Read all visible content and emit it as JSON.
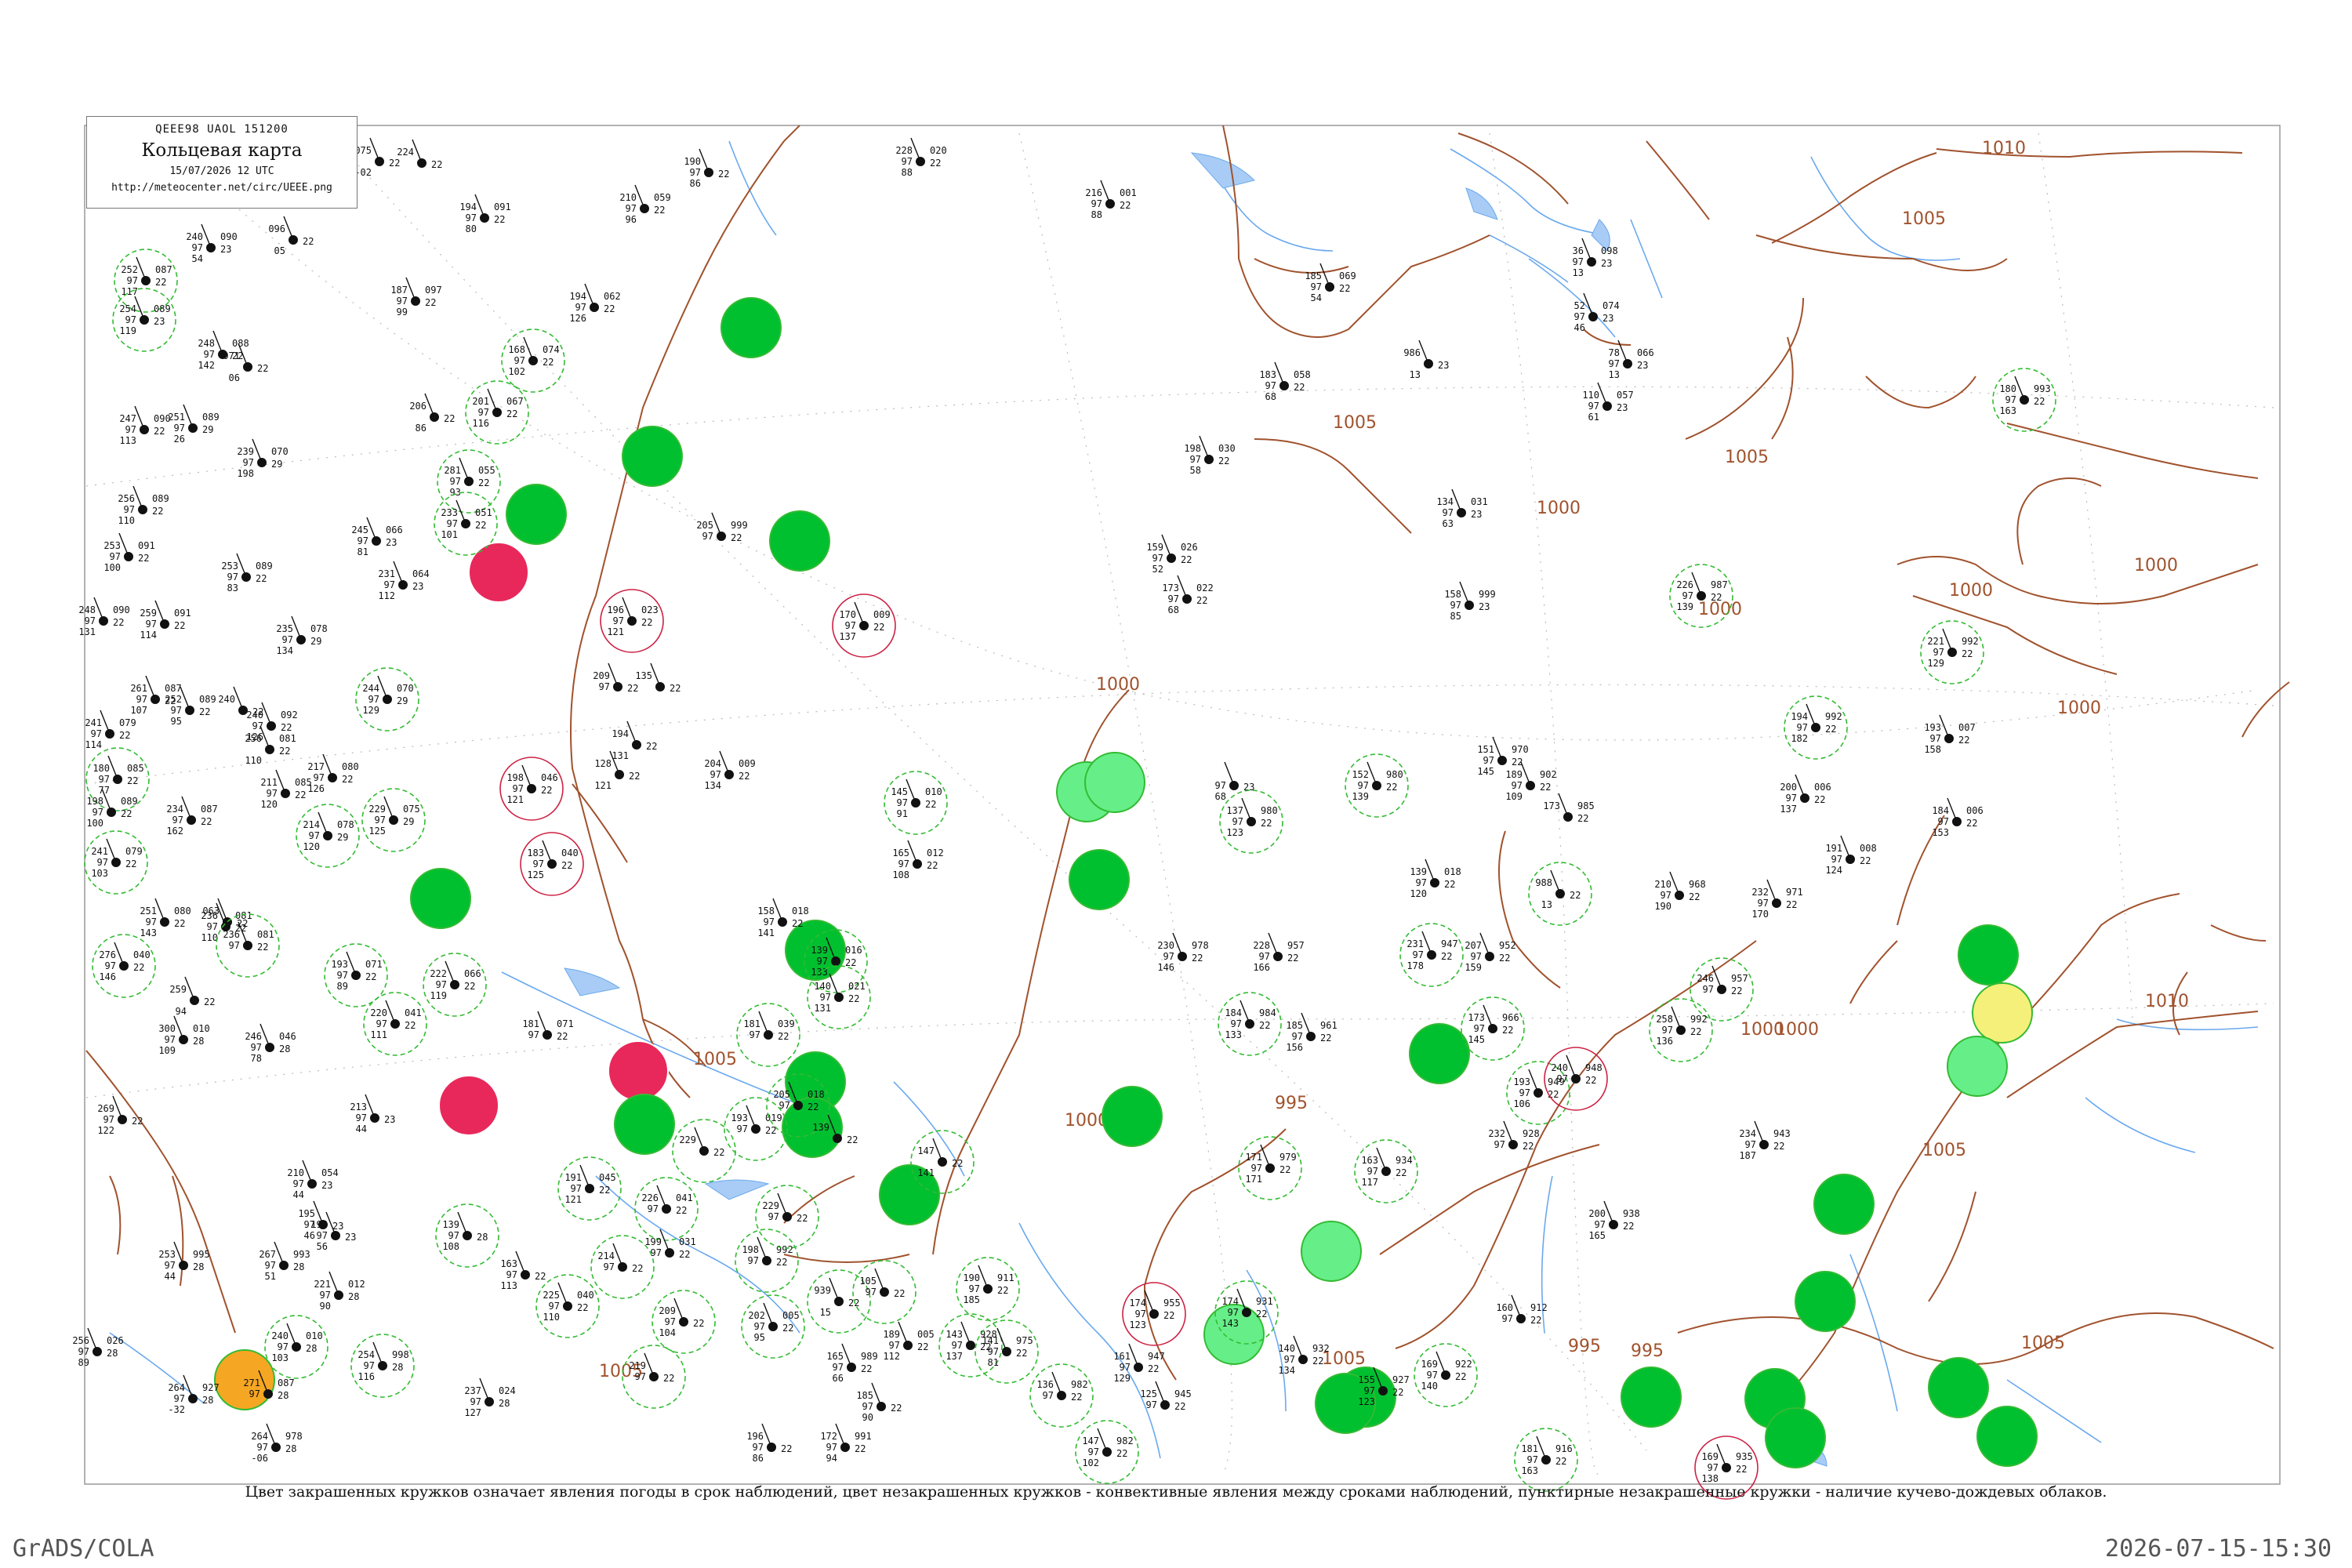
{
  "legend": {
    "code_line": "QEEE98  UAOL  151200",
    "title": "Кольцевая карта",
    "datetime": "15/07/2026 12 UTC",
    "url": "http://meteocenter.net/circ/UEEE.png"
  },
  "caption": "Цвет закрашенных кружков означает явления погоды в срок наблюдений, цвет незакрашенных кружков - конвективные явления между сроками наблюдений, пунктирные незакрашенные кружки - наличие кучево-дождевых облаков.",
  "footer": {
    "left": "GrADS/COLA",
    "right": "2026-07-15-15:30"
  },
  "colors": {
    "isobar": "#a0522d",
    "river": "#6aa9ee",
    "frame": "#999999",
    "rain_fill": "#00c030",
    "light_fill": "#66ee88",
    "storm_fill": "#e8285a",
    "fog_fill": "#f5f07a",
    "orange_fill": "#f5a623",
    "cb_ring": "#33bb33",
    "convective_ring": "#cc2244"
  },
  "isobars": [
    "1010",
    "1005",
    "1005",
    "1005",
    "1000",
    "1000",
    "1000",
    "1000",
    "1000",
    "1000",
    "995",
    "995",
    "1000",
    "1005",
    "1005",
    "1010",
    "1000",
    "1005",
    "1000",
    "1005",
    "1005",
    "995"
  ],
  "stations": [
    {
      "t": "252",
      "d": "087",
      "p": "97",
      "h": "117",
      "n": "22"
    },
    {
      "t": "254",
      "d": "089",
      "p": "97",
      "h": "119",
      "n": "23"
    },
    {
      "t": "240",
      "d": "090",
      "p": "97",
      "h": "54",
      "n": "23"
    },
    {
      "t": "248",
      "d": "088",
      "p": "97",
      "h": "142",
      "n": "22"
    },
    {
      "t": "247",
      "d": "090",
      "p": "97",
      "h": "113",
      "n": "22"
    },
    {
      "t": "251",
      "d": "089",
      "p": "97",
      "h": "26",
      "n": "29"
    },
    {
      "t": "239",
      "d": "070",
      "p": "97",
      "h": "198",
      "n": "29"
    },
    {
      "t": "256",
      "d": "089",
      "p": "97",
      "h": "110",
      "n": "22"
    },
    {
      "t": "253",
      "d": "091",
      "p": "97",
      "h": "100",
      "n": "22"
    },
    {
      "t": "253",
      "d": "089",
      "p": "97",
      "h": "83",
      "n": "22"
    },
    {
      "t": "248",
      "d": "090",
      "p": "97",
      "h": "131",
      "n": "22"
    },
    {
      "t": "259",
      "d": "091",
      "p": "97",
      "h": "114",
      "n": "22"
    },
    {
      "t": "235",
      "d": "078",
      "p": "97",
      "h": "134",
      "n": "29"
    },
    {
      "t": "245",
      "d": "066",
      "p": "97",
      "h": "81",
      "n": "23"
    },
    {
      "t": "231",
      "d": "064",
      "p": "97",
      "h": "112",
      "n": "23"
    },
    {
      "t": "261",
      "d": "087",
      "p": "97",
      "h": "107",
      "n": "22"
    },
    {
      "t": "252",
      "d": "089",
      "p": "97",
      "h": "95",
      "n": "22"
    },
    {
      "t": "240",
      "d": "092",
      "p": "97",
      "h": "126",
      "n": "22"
    },
    {
      "t": "244",
      "d": "070",
      "p": "97",
      "h": "129",
      "n": "29"
    },
    {
      "t": "241",
      "d": "079",
      "p": "97",
      "h": "114",
      "n": "22"
    },
    {
      "t": "180",
      "d": "085",
      "p": "97",
      "h": "77",
      "n": "22"
    },
    {
      "t": "198",
      "d": "089",
      "p": "97",
      "h": "100",
      "n": "22"
    },
    {
      "t": "211",
      "d": "085",
      "p": "97",
      "h": "120",
      "n": "22"
    },
    {
      "t": "217",
      "d": "080",
      "p": "97",
      "h": "126",
      "n": "22"
    },
    {
      "t": "234",
      "d": "087",
      "p": "97",
      "h": "162",
      "n": "22"
    },
    {
      "t": "241",
      "d": "079",
      "p": "97",
      "h": "103",
      "n": "22"
    },
    {
      "t": "214",
      "d": "078",
      "p": "97",
      "h": "120",
      "n": "29"
    },
    {
      "t": "229",
      "d": "075",
      "p": "97",
      "h": "125",
      "n": "29"
    },
    {
      "t": "251",
      "d": "080",
      "p": "97",
      "h": "143",
      "n": "22"
    },
    {
      "t": "236",
      "d": "081",
      "p": "97",
      "h": "110",
      "n": "22"
    },
    {
      "t": "276",
      "d": "040",
      "p": "97",
      "h": "146",
      "n": "22"
    },
    {
      "t": "193",
      "d": "071",
      "p": "97",
      "h": "89",
      "n": "22"
    },
    {
      "t": "222",
      "d": "066",
      "p": "97",
      "h": "119",
      "n": "22"
    },
    {
      "t": "259",
      "d": "",
      "p": "",
      "h": "94",
      "n": "22"
    },
    {
      "t": "300",
      "d": "010",
      "p": "97",
      "h": "109",
      "n": "28"
    },
    {
      "t": "246",
      "d": "046",
      "p": "97",
      "h": "78",
      "n": "28"
    },
    {
      "t": "220",
      "d": "041",
      "p": "97",
      "h": "111",
      "n": "22"
    },
    {
      "t": "269",
      "d": "",
      "p": "97",
      "h": "122",
      "n": "22"
    },
    {
      "t": "213",
      "d": "",
      "p": "97",
      "h": "44",
      "n": "23"
    },
    {
      "t": "210",
      "d": "054",
      "p": "97",
      "h": "44",
      "n": "23"
    },
    {
      "t": "194",
      "d": "",
      "p": "97",
      "h": "56",
      "n": "23"
    },
    {
      "t": "195",
      "d": "",
      "p": "97",
      "h": "46",
      "n": "23"
    },
    {
      "t": "253",
      "d": "995",
      "p": "97",
      "h": "44",
      "n": "28"
    },
    {
      "t": "267",
      "d": "993",
      "p": "97",
      "h": "51",
      "n": "28"
    },
    {
      "t": "221",
      "d": "012",
      "p": "97",
      "h": "90",
      "n": "28"
    },
    {
      "t": "240",
      "d": "010",
      "p": "97",
      "h": "103",
      "n": "28"
    },
    {
      "t": "254",
      "d": "998",
      "p": "97",
      "h": "116",
      "n": "28"
    },
    {
      "t": "264",
      "d": "927",
      "p": "97",
      "h": "-32",
      "n": "28"
    },
    {
      "t": "271",
      "d": "087",
      "p": "97",
      "h": "",
      "n": "28"
    },
    {
      "t": "264",
      "d": "978",
      "p": "97",
      "h": "-06",
      "n": "28"
    },
    {
      "t": "256",
      "d": "026",
      "p": "97",
      "h": "89",
      "n": "28"
    },
    {
      "t": "237",
      "d": "024",
      "p": "97",
      "h": "127",
      "n": "28"
    },
    {
      "t": "139",
      "d": "",
      "p": "97",
      "h": "108",
      "n": "28"
    },
    {
      "t": "191",
      "d": "045",
      "p": "97",
      "h": "121",
      "n": "22"
    },
    {
      "t": "163",
      "d": "",
      "p": "97",
      "h": "113",
      "n": "22"
    },
    {
      "t": "225",
      "d": "040",
      "p": "97",
      "h": "110",
      "n": "22"
    },
    {
      "t": "209",
      "d": "",
      "p": "97",
      "h": "104",
      "n": "22"
    },
    {
      "t": "219",
      "d": "",
      "p": "97",
      "h": "",
      "n": "22"
    },
    {
      "t": "190",
      "d": "",
      "p": "97",
      "h": "86",
      "n": "22"
    },
    {
      "t": "194",
      "d": "091",
      "p": "97",
      "h": "80",
      "n": "22"
    },
    {
      "t": "210",
      "d": "059",
      "p": "97",
      "h": "96",
      "n": "22"
    },
    {
      "t": "187",
      "d": "097",
      "p": "97",
      "h": "99",
      "n": "22"
    },
    {
      "t": "194",
      "d": "062",
      "p": "97",
      "h": "126",
      "n": "22"
    },
    {
      "t": "168",
      "d": "074",
      "p": "97",
      "h": "102",
      "n": "22"
    },
    {
      "t": "201",
      "d": "067",
      "p": "97",
      "h": "116",
      "n": "22"
    },
    {
      "t": "206",
      "d": "",
      "p": "",
      "h": "86",
      "n": "22"
    },
    {
      "t": "281",
      "d": "055",
      "p": "97",
      "h": "93",
      "n": "22"
    },
    {
      "t": "233",
      "d": "051",
      "p": "97",
      "h": "101",
      "n": "22"
    },
    {
      "t": "196",
      "d": "023",
      "p": "97",
      "h": "121",
      "n": "22"
    },
    {
      "t": "205",
      "d": "999",
      "p": "97",
      "h": "",
      "n": "22"
    },
    {
      "t": "170",
      "d": "009",
      "p": "97",
      "h": "137",
      "n": "22"
    },
    {
      "t": "198",
      "d": "046",
      "p": "97",
      "h": "121",
      "n": "22"
    },
    {
      "t": "183",
      "d": "040",
      "p": "97",
      "h": "125",
      "n": "22"
    },
    {
      "t": "204",
      "d": "009",
      "p": "97",
      "h": "134",
      "n": "22"
    },
    {
      "t": "145",
      "d": "010",
      "p": "97",
      "h": "91",
      "n": "22"
    },
    {
      "t": "165",
      "d": "012",
      "p": "97",
      "h": "108",
      "n": "22"
    },
    {
      "t": "158",
      "d": "018",
      "p": "97",
      "h": "141",
      "n": "22"
    },
    {
      "t": "139",
      "d": "016",
      "p": "97",
      "h": "133",
      "n": "22"
    },
    {
      "t": "140",
      "d": "021",
      "p": "97",
      "h": "131",
      "n": "22"
    },
    {
      "t": "216",
      "d": "001",
      "p": "97",
      "h": "88",
      "n": "22"
    },
    {
      "t": "228",
      "d": "020",
      "p": "97",
      "h": "88",
      "n": "22"
    },
    {
      "t": "185",
      "d": "069",
      "p": "97",
      "h": "54",
      "n": "22"
    },
    {
      "t": "183",
      "d": "058",
      "p": "97",
      "h": "68",
      "n": "22"
    },
    {
      "t": "198",
      "d": "030",
      "p": "97",
      "h": "58",
      "n": "22"
    },
    {
      "t": "159",
      "d": "026",
      "p": "97",
      "h": "52",
      "n": "22"
    },
    {
      "t": "173",
      "d": "022",
      "p": "97",
      "h": "68",
      "n": "22"
    },
    {
      "t": "134",
      "d": "031",
      "p": "97",
      "h": "63",
      "n": "23"
    },
    {
      "t": "158",
      "d": "999",
      "p": "97",
      "h": "85",
      "n": "23"
    },
    {
      "t": "36",
      "d": "098",
      "p": "97",
      "h": "13",
      "n": "23"
    },
    {
      "t": "52",
      "d": "074",
      "p": "97",
      "h": "46",
      "n": "23"
    },
    {
      "t": "78",
      "d": "066",
      "p": "97",
      "h": "13",
      "n": "23"
    },
    {
      "t": "110",
      "d": "057",
      "p": "97",
      "h": "61",
      "n": "23"
    },
    {
      "t": "986",
      "d": "",
      "p": "",
      "h": "13",
      "n": "23"
    },
    {
      "t": "",
      "d": "",
      "p": "97",
      "h": "68",
      "n": "23"
    },
    {
      "t": "137",
      "d": "980",
      "p": "97",
      "h": "123",
      "n": "22"
    },
    {
      "t": "152",
      "d": "980",
      "p": "97",
      "h": "139",
      "n": "22"
    },
    {
      "t": "151",
      "d": "970",
      "p": "97",
      "h": "145",
      "n": "22"
    },
    {
      "t": "189",
      "d": "902",
      "p": "97",
      "h": "109",
      "n": "22"
    },
    {
      "t": "173",
      "d": "985",
      "p": "",
      "h": "",
      "n": "22"
    },
    {
      "t": "194",
      "d": "992",
      "p": "97",
      "h": "182",
      "n": "22"
    },
    {
      "t": "200",
      "d": "006",
      "p": "97",
      "h": "137",
      "n": "22"
    },
    {
      "t": "193",
      "d": "007",
      "p": "97",
      "h": "158",
      "n": "22"
    },
    {
      "t": "184",
      "d": "006",
      "p": "97",
      "h": "153",
      "n": "22"
    },
    {
      "t": "191",
      "d": "008",
      "p": "97",
      "h": "124",
      "n": "22"
    },
    {
      "t": "226",
      "d": "987",
      "p": "97",
      "h": "139",
      "n": "22"
    },
    {
      "t": "221",
      "d": "992",
      "p": "97",
      "h": "129",
      "n": "22"
    },
    {
      "t": "180",
      "d": "993",
      "p": "97",
      "h": "163",
      "n": "22"
    },
    {
      "t": "139",
      "d": "018",
      "p": "97",
      "h": "120",
      "n": "22"
    },
    {
      "t": "231",
      "d": "947",
      "p": "97",
      "h": "178",
      "n": "22"
    },
    {
      "t": "207",
      "d": "952",
      "p": "97",
      "h": "159",
      "n": "22"
    },
    {
      "t": "988",
      "d": "",
      "p": "",
      "h": "13",
      "n": "22"
    },
    {
      "t": "210",
      "d": "968",
      "p": "97",
      "h": "190",
      "n": "22"
    },
    {
      "t": "232",
      "d": "971",
      "p": "97",
      "h": "170",
      "n": "22"
    },
    {
      "t": "246",
      "d": "957",
      "p": "97",
      "h": "",
      "n": "22"
    },
    {
      "t": "258",
      "d": "992",
      "p": "97",
      "h": "136",
      "n": "22"
    },
    {
      "t": "230",
      "d": "978",
      "p": "97",
      "h": "146",
      "n": "22"
    },
    {
      "t": "228",
      "d": "957",
      "p": "97",
      "h": "166",
      "n": "22"
    },
    {
      "t": "184",
      "d": "984",
      "p": "97",
      "h": "133",
      "n": "22"
    },
    {
      "t": "185",
      "d": "961",
      "p": "97",
      "h": "156",
      "n": "22"
    },
    {
      "t": "173",
      "d": "966",
      "p": "97",
      "h": "145",
      "n": "22"
    },
    {
      "t": "193",
      "d": "949",
      "p": "97",
      "h": "106",
      "n": "22"
    },
    {
      "t": "240",
      "d": "948",
      "p": "97",
      "h": "",
      "n": "22"
    },
    {
      "t": "232",
      "d": "928",
      "p": "97",
      "h": "",
      "n": "22"
    },
    {
      "t": "234",
      "d": "943",
      "p": "97",
      "h": "187",
      "n": "22"
    },
    {
      "t": "200",
      "d": "938",
      "p": "97",
      "h": "165",
      "n": "22"
    },
    {
      "t": "171",
      "d": "979",
      "p": "97",
      "h": "171",
      "n": "22"
    },
    {
      "t": "163",
      "d": "934",
      "p": "97",
      "h": "117",
      "n": "22"
    },
    {
      "t": "174",
      "d": "931",
      "p": "97",
      "h": "143",
      "n": "22"
    },
    {
      "t": "140",
      "d": "932",
      "p": "97",
      "h": "134",
      "n": "22"
    },
    {
      "t": "155",
      "d": "927",
      "p": "97",
      "h": "123",
      "n": "22"
    },
    {
      "t": "169",
      "d": "922",
      "p": "97",
      "h": "140",
      "n": "22"
    },
    {
      "t": "160",
      "d": "912",
      "p": "97",
      "h": "",
      "n": "22"
    },
    {
      "t": "181",
      "d": "916",
      "p": "97",
      "h": "163",
      "n": "22"
    },
    {
      "t": "169",
      "d": "935",
      "p": "97",
      "h": "138",
      "n": "22"
    },
    {
      "t": "190",
      "d": "911",
      "p": "97",
      "h": "185",
      "n": "22"
    },
    {
      "t": "143",
      "d": "928",
      "p": "97",
      "h": "137",
      "n": "22"
    },
    {
      "t": "141",
      "d": "975",
      "p": "97",
      "h": "81",
      "n": "22"
    },
    {
      "t": "136",
      "d": "982",
      "p": "97",
      "h": "",
      "n": "22"
    },
    {
      "t": "147",
      "d": "982",
      "p": "97",
      "h": "102",
      "n": "22"
    },
    {
      "t": "174",
      "d": "955",
      "p": "97",
      "h": "123",
      "n": "22"
    },
    {
      "t": "161",
      "d": "947",
      "p": "97",
      "h": "129",
      "n": "22"
    },
    {
      "t": "125",
      "d": "945",
      "p": "97",
      "h": "",
      "n": "22"
    },
    {
      "t": "147",
      "d": "",
      "p": "",
      "h": "141",
      "n": "22"
    },
    {
      "t": "939",
      "d": "",
      "p": "",
      "h": "15",
      "n": "22"
    },
    {
      "t": "105",
      "d": "",
      "p": "97",
      "h": "",
      "n": "22"
    },
    {
      "t": "189",
      "d": "005",
      "p": "97",
      "h": "112",
      "n": "22"
    },
    {
      "t": "165",
      "d": "989",
      "p": "97",
      "h": "66",
      "n": "22"
    },
    {
      "t": "185",
      "d": "",
      "p": "97",
      "h": "90",
      "n": "22"
    },
    {
      "t": "196",
      "d": "",
      "p": "97",
      "h": "86",
      "n": "22"
    },
    {
      "t": "172",
      "d": "991",
      "p": "97",
      "h": "94",
      "n": "22"
    },
    {
      "t": "202",
      "d": "005",
      "p": "97",
      "h": "95",
      "n": "22"
    },
    {
      "t": "198",
      "d": "992",
      "p": "97",
      "h": "",
      "n": "22"
    },
    {
      "t": "193",
      "d": "019",
      "p": "97",
      "h": "",
      "n": "22"
    },
    {
      "t": "205",
      "d": "018",
      "p": "97",
      "h": "",
      "n": "22"
    },
    {
      "t": "181",
      "d": "039",
      "p": "97",
      "h": "",
      "n": "22"
    },
    {
      "t": "139",
      "d": "",
      "p": "",
      "h": "",
      "n": "22"
    },
    {
      "t": "229",
      "d": "",
      "p": "",
      "h": "",
      "n": "22"
    },
    {
      "t": "181",
      "d": "071",
      "p": "97",
      "h": "",
      "n": "22"
    },
    {
      "t": "226",
      "d": "041",
      "p": "97",
      "h": "",
      "n": "22"
    },
    {
      "t": "214",
      "d": "",
      "p": "97",
      "h": "",
      "n": "22"
    },
    {
      "t": "229",
      "d": "",
      "p": "97",
      "h": "",
      "n": "22"
    },
    {
      "t": "199",
      "d": "031",
      "p": "97",
      "h": "",
      "n": "22"
    },
    {
      "t": "209",
      "d": "",
      "p": "97",
      "h": "",
      "n": "22"
    },
    {
      "t": "135",
      "d": "",
      "p": "",
      "h": "",
      "n": "22"
    },
    {
      "t": "194",
      "d": "",
      "p": "",
      "h": "131",
      "n": "22"
    },
    {
      "t": "128",
      "d": "",
      "p": "",
      "h": "121",
      "n": "22"
    },
    {
      "t": "071",
      "d": "",
      "p": "",
      "h": "06",
      "n": "22"
    },
    {
      "t": "075",
      "d": "",
      "p": "",
      "h": "-02",
      "n": "22"
    },
    {
      "t": "096",
      "d": "",
      "p": "",
      "h": "05",
      "n": "22"
    },
    {
      "t": "063",
      "d": "",
      "p": "",
      "h": "",
      "n": "22"
    },
    {
      "t": "236",
      "d": "081",
      "p": "97",
      "h": "",
      "n": "22"
    },
    {
      "t": "256",
      "d": "081",
      "p": "",
      "h": "110",
      "n": "22"
    },
    {
      "t": "240",
      "d": "",
      "p": "",
      "h": "",
      "n": "22"
    },
    {
      "t": "224",
      "d": "",
      "p": "",
      "h": "",
      "n": "22"
    },
    {
      "t": "096",
      "d": "",
      "p": "",
      "h": "",
      "n": "22"
    }
  ]
}
